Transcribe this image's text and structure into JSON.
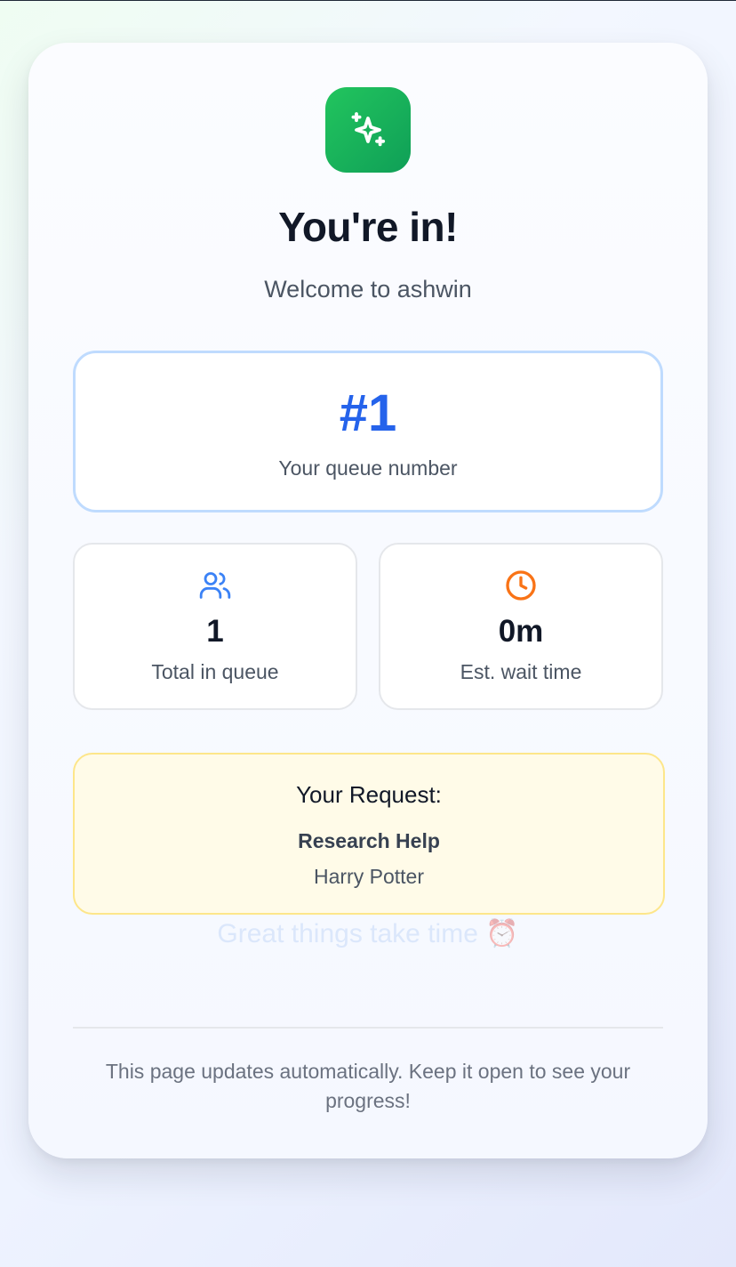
{
  "header": {
    "title": "You're in!",
    "subtitle": "Welcome to ashwin"
  },
  "queue": {
    "number": "#1",
    "label": "Your queue number"
  },
  "stats": {
    "total": {
      "value": "1",
      "label": "Total in queue",
      "icon": "users-icon"
    },
    "wait": {
      "value": "0m",
      "label": "Est. wait time",
      "icon": "clock-icon"
    }
  },
  "request": {
    "heading": "Your Request:",
    "type": "Research Help",
    "detail": "Harry Potter"
  },
  "motivation": {
    "text": "Great things take time",
    "emoji": "⏰"
  },
  "footer": {
    "note": "This page updates automatically. Keep it open to see your progress!"
  },
  "colors": {
    "brand_green": "#16a34a",
    "accent_blue": "#2563eb",
    "accent_orange": "#f97316",
    "request_bg": "#fffbe8",
    "request_border": "#fde68a"
  }
}
